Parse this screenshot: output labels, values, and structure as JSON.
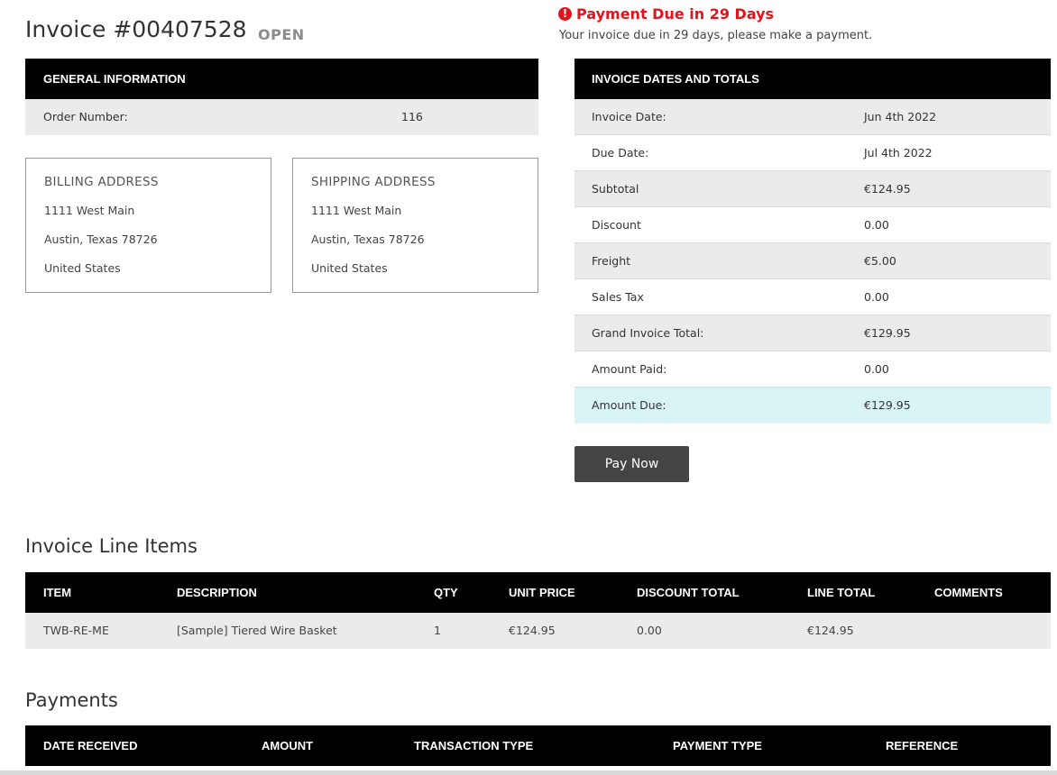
{
  "invoice": {
    "title": "Invoice #00407528",
    "status": "OPEN"
  },
  "alert": {
    "title": "Payment Due in 29 Days",
    "text": "Your invoice due in 29 days, please make a payment.",
    "icon": "exclamation-circle-icon",
    "color": "#e0141c"
  },
  "general": {
    "heading": "GENERAL INFORMATION",
    "order_label": "Order Number:",
    "order_value": "116"
  },
  "billing": {
    "heading": "BILLING ADDRESS",
    "line1": "1111 West Main",
    "line2": "Austin, Texas 78726",
    "line3": "United States"
  },
  "shipping": {
    "heading": "SHIPPING ADDRESS",
    "line1": "1111 West Main",
    "line2": "Austin, Texas 78726",
    "line3": "United States"
  },
  "totals": {
    "heading": "INVOICE DATES AND TOTALS",
    "rows": [
      {
        "label": "Invoice Date:",
        "value": "Jun 4th 2022"
      },
      {
        "label": "Due Date:",
        "value": "Jul 4th 2022"
      },
      {
        "label": "Subtotal",
        "value": "€124.95"
      },
      {
        "label": "Discount",
        "value": "0.00"
      },
      {
        "label": "Freight",
        "value": "€5.00"
      },
      {
        "label": "Sales Tax",
        "value": "0.00"
      },
      {
        "label": "Grand Invoice Total:",
        "value": "€129.95"
      },
      {
        "label": "Amount Paid:",
        "value": "0.00"
      },
      {
        "label": "Amount Due:",
        "value": "€129.95"
      }
    ]
  },
  "pay_button": "Pay Now",
  "line_items": {
    "title": "Invoice Line Items",
    "columns": [
      "ITEM",
      "DESCRIPTION",
      "QTY",
      "UNIT PRICE",
      "DISCOUNT TOTAL",
      "LINE TOTAL",
      "COMMENTS"
    ],
    "rows": [
      {
        "item": "TWB-RE-ME",
        "description": "[Sample] Tiered Wire Basket",
        "qty": "1",
        "unit_price": "€124.95",
        "discount_total": "0.00",
        "line_total": "€124.95",
        "comments": ""
      }
    ]
  },
  "payments": {
    "title": "Payments",
    "columns": [
      "DATE RECEIVED",
      "AMOUNT",
      "TRANSACTION TYPE",
      "PAYMENT TYPE",
      "REFERENCE"
    ]
  }
}
